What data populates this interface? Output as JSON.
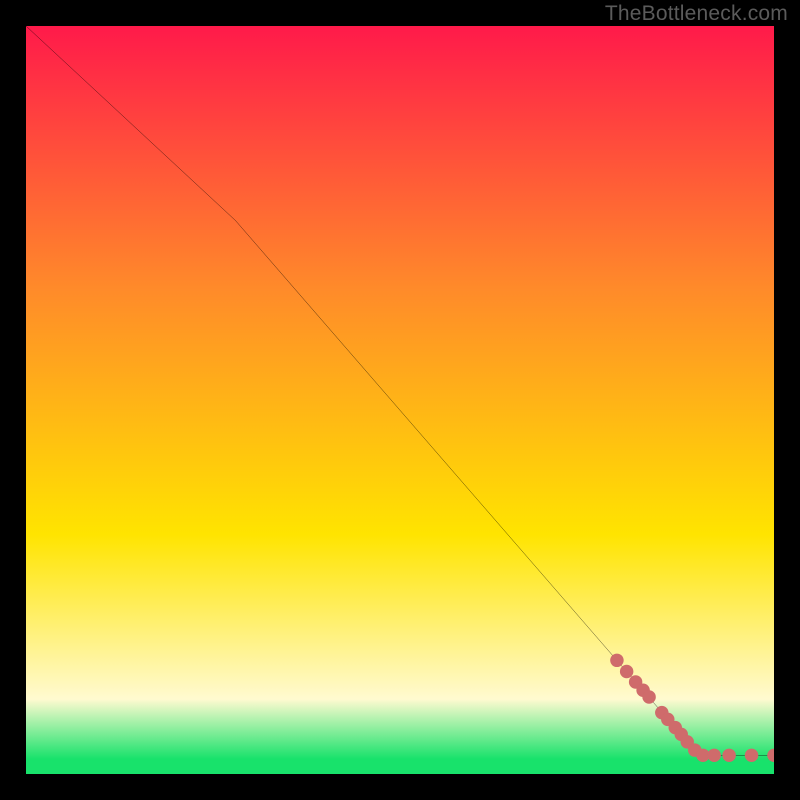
{
  "watermark": "TheBottleneck.com",
  "colors": {
    "background": "#000000",
    "gradient_top": "#ff1a4a",
    "gradient_mid1": "#ff8a2a",
    "gradient_mid2": "#ffe400",
    "gradient_bottom_soft": "#fffad0",
    "gradient_green": "#18e26b",
    "line": "#000000",
    "marker": "#cf6b6b"
  },
  "chart_data": {
    "type": "line",
    "title": "",
    "xlabel": "",
    "ylabel": "",
    "xlim": [
      0,
      100
    ],
    "ylim": [
      0,
      100
    ],
    "line_points": [
      {
        "x": 0,
        "y": 100
      },
      {
        "x": 28,
        "y": 74
      },
      {
        "x": 90,
        "y": 2.5
      },
      {
        "x": 100,
        "y": 2.5
      }
    ],
    "markers": [
      {
        "x": 79.0,
        "y": 15.2
      },
      {
        "x": 80.3,
        "y": 13.7
      },
      {
        "x": 81.5,
        "y": 12.3
      },
      {
        "x": 82.5,
        "y": 11.2
      },
      {
        "x": 83.3,
        "y": 10.3
      },
      {
        "x": 85.0,
        "y": 8.2
      },
      {
        "x": 85.8,
        "y": 7.3
      },
      {
        "x": 86.8,
        "y": 6.2
      },
      {
        "x": 87.6,
        "y": 5.3
      },
      {
        "x": 88.4,
        "y": 4.3
      },
      {
        "x": 89.4,
        "y": 3.2
      },
      {
        "x": 90.5,
        "y": 2.5
      },
      {
        "x": 92.0,
        "y": 2.5
      },
      {
        "x": 94.0,
        "y": 2.5
      },
      {
        "x": 97.0,
        "y": 2.5
      },
      {
        "x": 100.0,
        "y": 2.5
      }
    ]
  }
}
